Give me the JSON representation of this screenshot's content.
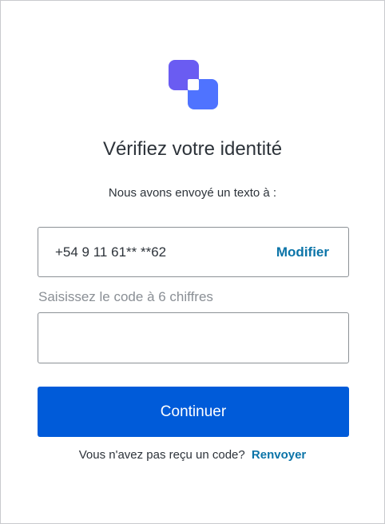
{
  "colors": {
    "brand_primary": "#005bd9",
    "link": "#0b74a8",
    "logo_back": "#6a5cf2",
    "logo_front": "#4f73ff",
    "text": "#2d333a",
    "muted_text": "#8a8f95",
    "border": "#8c9196"
  },
  "logo": {
    "icon": "overlapping-squares-logo-icon"
  },
  "heading": {
    "title": "Vérifiez votre identité",
    "subtitle": "Nous avons envoyé un texto à :"
  },
  "phone": {
    "number": "+54 9 11 61** **62",
    "modify_label": "Modifier"
  },
  "code_field": {
    "label": "Saisissez le code à 6 chiffres",
    "value": "",
    "placeholder": ""
  },
  "actions": {
    "continue_label": "Continuer"
  },
  "resend": {
    "prompt": "Vous n'avez pas reçu un code?",
    "link_label": "Renvoyer"
  }
}
